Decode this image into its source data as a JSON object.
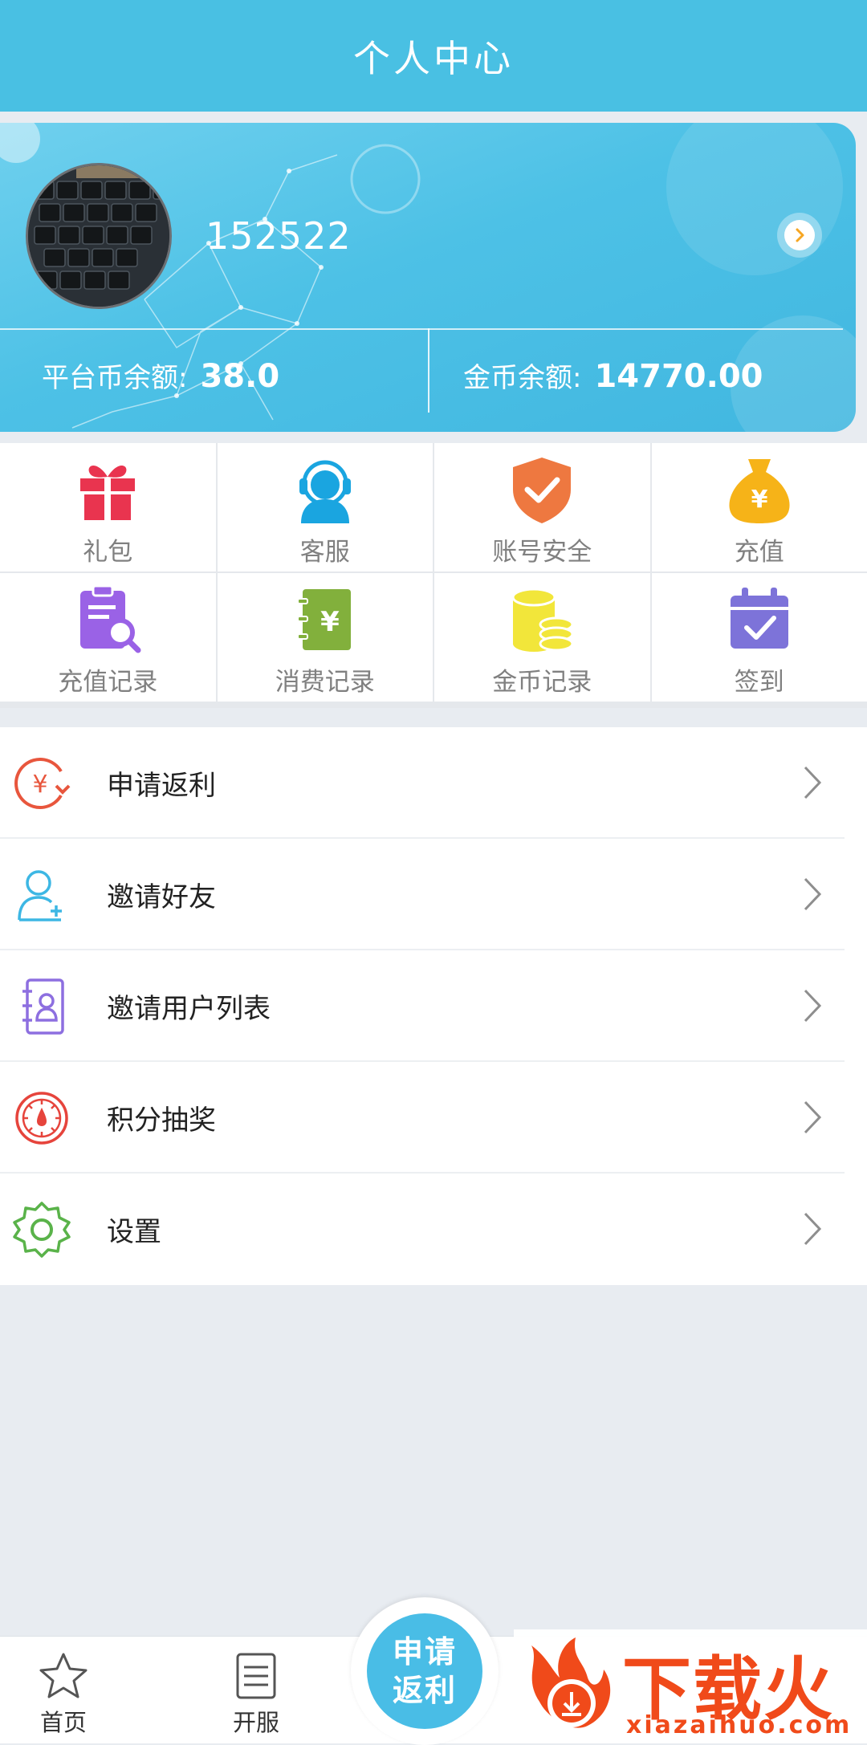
{
  "header": {
    "title": "个人中心"
  },
  "profile": {
    "username": "152522",
    "platform_balance_label": "平台币余额:",
    "platform_balance_value": "38.0",
    "gold_balance_label": "金币余额:",
    "gold_balance_value": "14770.00"
  },
  "grid": [
    {
      "label": "礼包",
      "icon": "gift-icon",
      "color": "#e9344f"
    },
    {
      "label": "客服",
      "icon": "customer-service-icon",
      "color": "#1aa5e0"
    },
    {
      "label": "账号安全",
      "icon": "shield-check-icon",
      "color": "#ee7840"
    },
    {
      "label": "充值",
      "icon": "money-bag-icon",
      "color": "#f6b318"
    },
    {
      "label": "充值记录",
      "icon": "clipboard-search-icon",
      "color": "#9a62e6"
    },
    {
      "label": "消费记录",
      "icon": "ledger-icon",
      "color": "#82b03c"
    },
    {
      "label": "金币记录",
      "icon": "coins-icon",
      "color": "#f2e63a"
    },
    {
      "label": "签到",
      "icon": "calendar-check-icon",
      "color": "#7d73d9"
    }
  ],
  "menu": [
    {
      "label": "申请返利",
      "icon": "rebate-icon",
      "color": "#e8563d"
    },
    {
      "label": " 邀请好友",
      "icon": "add-user-icon",
      "color": "#3db7e4"
    },
    {
      "label": "邀请用户列表",
      "icon": "contact-list-icon",
      "color": "#8d6fe0"
    },
    {
      "label": "积分抽奖",
      "icon": "lottery-dial-icon",
      "color": "#e6443c"
    },
    {
      "label": "设置",
      "icon": "gear-icon",
      "color": "#5ab34a"
    }
  ],
  "bottom_nav": {
    "home_label": "首页",
    "server_label": "开服",
    "fab_line1": "申请",
    "fab_line2": "返利"
  },
  "watermark": {
    "brand": "下载火",
    "domain": "xiazaihuo.com"
  },
  "colors": {
    "accent": "#49c0e3",
    "background": "#e8ecf1"
  }
}
